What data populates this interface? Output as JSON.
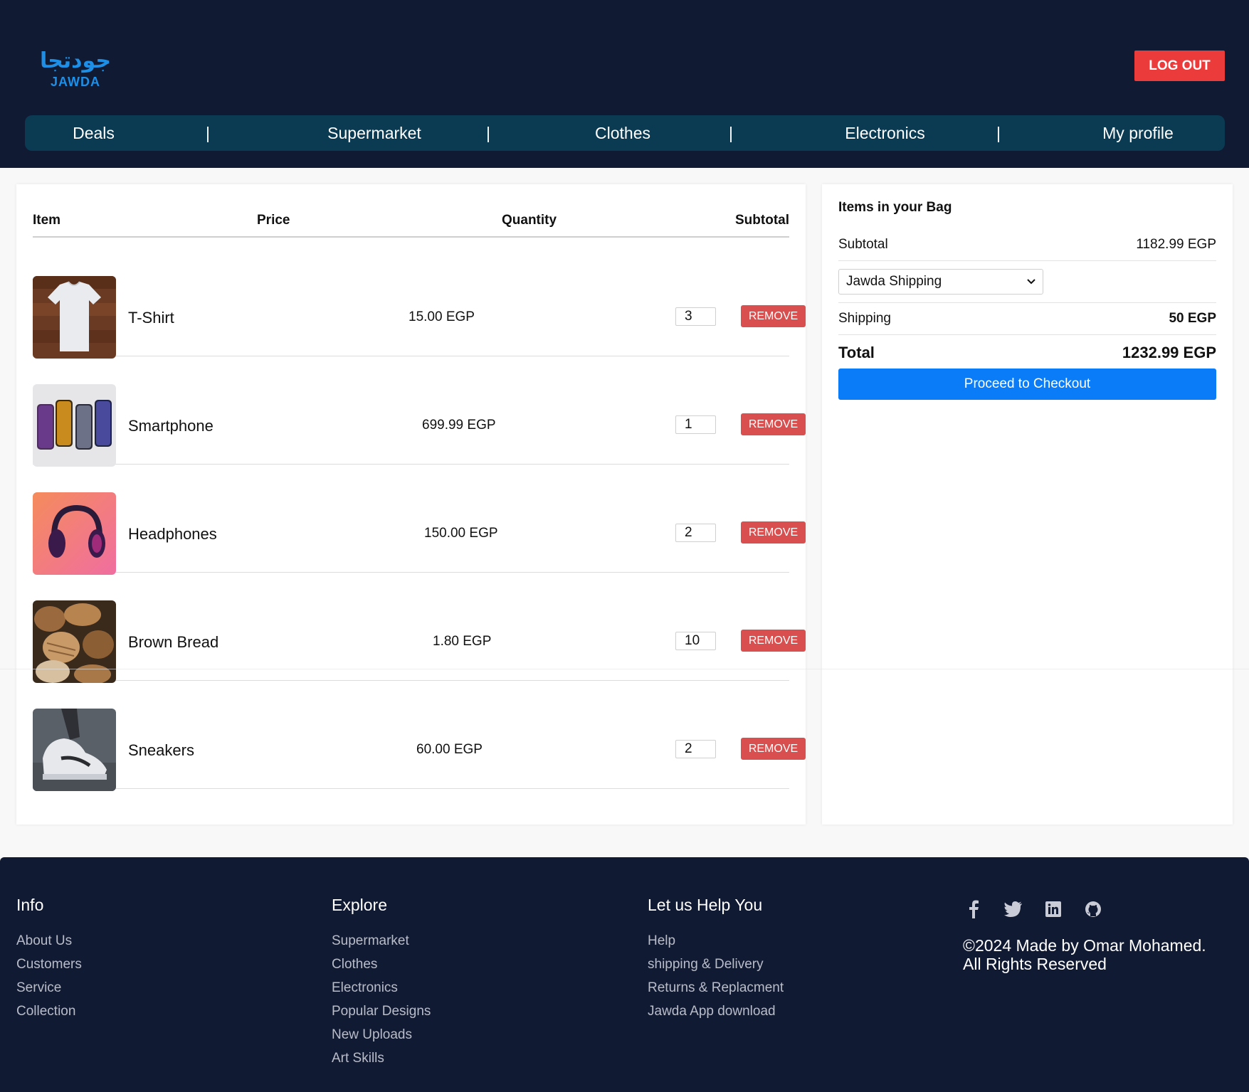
{
  "brand": {
    "arabic": "جودتجا",
    "latin": "JAWDA"
  },
  "header": {
    "logout_label": "LOG OUT"
  },
  "nav": {
    "items": [
      "Deals",
      "Supermarket",
      "Clothes",
      "Electronics",
      "My profile"
    ],
    "separator": "|"
  },
  "cart": {
    "columns": {
      "item": "Item",
      "price": "Price",
      "quantity": "Quantity",
      "subtotal": "Subtotal"
    },
    "remove_label": "REMOVE",
    "rows": [
      {
        "name": "T-Shirt",
        "price": "15.00 EGP",
        "qty": "3"
      },
      {
        "name": "Smartphone",
        "price": "699.99 EGP",
        "qty": "1"
      },
      {
        "name": "Headphones",
        "price": "150.00 EGP",
        "qty": "2"
      },
      {
        "name": "Brown Bread",
        "price": "1.80 EGP",
        "qty": "10"
      },
      {
        "name": "Sneakers",
        "price": "60.00 EGP",
        "qty": "2"
      }
    ]
  },
  "summary": {
    "title": "Items in your Bag",
    "subtotal_label": "Subtotal",
    "subtotal_value": "1182.99 EGP",
    "shipping_option": "Jawda Shipping",
    "shipping_label": "Shipping",
    "shipping_value": "50 EGP",
    "total_label": "Total",
    "total_value": "1232.99 EGP",
    "checkout_label": "Proceed to Checkout"
  },
  "footer": {
    "info": {
      "title": "Info",
      "links": [
        "About Us",
        "Customers",
        "Service",
        "Collection"
      ]
    },
    "explore": {
      "title": "Explore",
      "links": [
        "Supermarket",
        "Clothes",
        "Electronics",
        "Popular Designs",
        "New Uploads",
        "Art Skills"
      ]
    },
    "help": {
      "title": "Let us Help You",
      "links": [
        "Help",
        "shipping & Delivery",
        "Returns & Replacment",
        "Jawda App download"
      ]
    },
    "socials": [
      "facebook-icon",
      "twitter-icon",
      "linkedin-icon",
      "github-icon"
    ],
    "copyright_line1": "©2024 Made by Omar Mohamed.",
    "copyright_line2": "All Rights Reserved"
  },
  "colors": {
    "header_bg": "#111a33",
    "nav_bg": "#0b3b52",
    "logout": "#ec3b3b",
    "remove": "#d94f4f",
    "checkout": "#0a7cf8",
    "brand": "#1e8fe6"
  }
}
